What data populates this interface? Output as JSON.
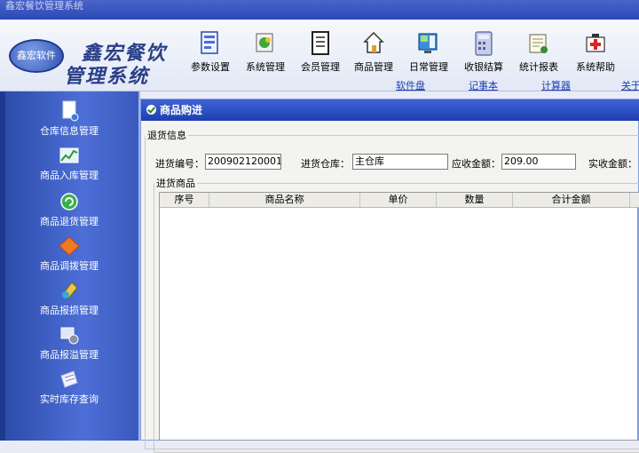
{
  "app": {
    "title": "鑫宏餐饮管理系统"
  },
  "brand": {
    "badge_text": "鑫宏软件",
    "line1": "鑫宏餐饮",
    "line2": "管理系统"
  },
  "toolbar": {
    "items": [
      {
        "label": "参数设置",
        "icon": "settings-doc-icon"
      },
      {
        "label": "系统管理",
        "icon": "system-puzzle-icon"
      },
      {
        "label": "会员管理",
        "icon": "member-ledger-icon"
      },
      {
        "label": "商品管理",
        "icon": "home-icon"
      },
      {
        "label": "日常管理",
        "icon": "daily-screen-icon"
      },
      {
        "label": "收银结算",
        "icon": "calculator-icon"
      },
      {
        "label": "统计报表",
        "icon": "report-icon"
      },
      {
        "label": "系统帮助",
        "icon": "help-first-aid-icon"
      }
    ],
    "links": [
      "软件盘",
      "记事本",
      "计算器",
      "关于"
    ]
  },
  "sidebar": {
    "items": [
      {
        "label": "仓库信息管理",
        "icon": "warehouse-doc-icon"
      },
      {
        "label": "商品入库管理",
        "icon": "stock-in-chart-icon"
      },
      {
        "label": "商品退货管理",
        "icon": "return-icon"
      },
      {
        "label": "商品调拨管理",
        "icon": "transfer-diamond-icon"
      },
      {
        "label": "商品报损管理",
        "icon": "loss-report-icon"
      },
      {
        "label": "商品报溢管理",
        "icon": "overflow-report-icon"
      },
      {
        "label": "实时库存查询",
        "icon": "stock-query-icon"
      }
    ]
  },
  "window": {
    "title": "商品购进",
    "group_info": "退货信息",
    "fields": {
      "purchase_no_label": "进货编号：",
      "purchase_no_value": "200902120001",
      "warehouse_label": "进货仓库：",
      "warehouse_value": "主仓库",
      "receivable_label": "应收金额：",
      "receivable_value": "209.00",
      "received_label": "实收金额："
    },
    "group_goods": "进货商品",
    "columns": [
      "序号",
      "商品名称",
      "单价",
      "数量",
      "合计金额"
    ]
  },
  "colors": {
    "accent": "#2b48b8",
    "sidebar": "#4d6fd6",
    "link": "#1d3fb0"
  }
}
